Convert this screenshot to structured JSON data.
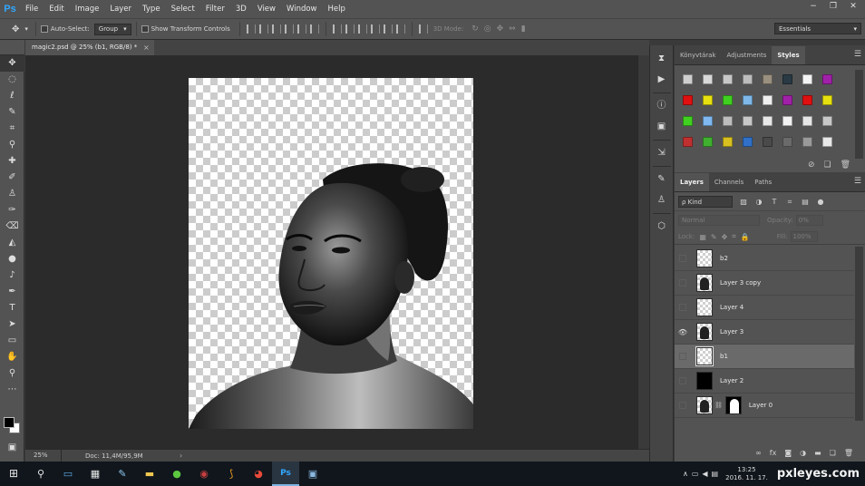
{
  "app": {
    "logo": "Ps",
    "menus": [
      "File",
      "Edit",
      "Image",
      "Layer",
      "Type",
      "Select",
      "Filter",
      "3D",
      "View",
      "Window",
      "Help"
    ],
    "window_controls": [
      "−",
      "❐",
      "✕"
    ]
  },
  "options_bar": {
    "auto_select_label": "Auto-Select:",
    "auto_select_target": "Group",
    "transform_controls_label": "Show Transform Controls",
    "mode_3d_label": "3D Mode:",
    "workspace": "Essentials"
  },
  "document": {
    "tab_title": "magic2.psd @ 25% (b1, RGB/8) *",
    "tab_close": "×",
    "zoom": "25%",
    "doc_size": "Doc: 11,4M/95,9M",
    "status_arrow": "›"
  },
  "styles_panel": {
    "tabs": [
      "Könyvtárak",
      "Adjustments",
      "Styles"
    ],
    "active_tab": "Styles",
    "swatches": [
      "#cfcfcf",
      "#d9d9d9",
      "#c8c8c8",
      "#bdbdbd",
      "#9a9080",
      "#2a3a44",
      "#f4f4f4",
      "#a020a8",
      "#e01010",
      "#e6e010",
      "#40d020",
      "#7fb8e8",
      "#f0f0f0",
      "#a020a8",
      "#e01010",
      "#e6e010",
      "#40d020",
      "#80b8f0",
      "#bdbdbd",
      "#c8c8c8",
      "#e8e8e8",
      "#f2f2f2",
      "#e6e6e6",
      "#c8c8c8",
      "#c03030",
      "#40b030",
      "#d8c020",
      "#3070c8",
      "#4a4a4a",
      "#6a6a6a",
      "#9a9a9a",
      "#e8e8e8"
    ]
  },
  "layers_panel": {
    "tabs": [
      "Layers",
      "Channels",
      "Paths"
    ],
    "active_tab": "Layers",
    "kind_label": "ρ Kind",
    "blend_mode": "Normal",
    "opacity_label": "Opacity:",
    "opacity_value": "0%",
    "lock_label": "Lock:",
    "fill_label": "Fill:",
    "fill_value": "100%",
    "layers": [
      {
        "name": "b2",
        "visible": false,
        "thumb": "transparent"
      },
      {
        "name": "Layer 3 copy",
        "visible": false,
        "thumb": "face"
      },
      {
        "name": "Layer 4",
        "visible": false,
        "thumb": "transparent"
      },
      {
        "name": "Layer 3",
        "visible": true,
        "thumb": "face"
      },
      {
        "name": "b1",
        "visible": false,
        "thumb": "transparent",
        "selected": true
      },
      {
        "name": "Layer 2",
        "visible": false,
        "thumb": "black"
      },
      {
        "name": "Layer 0",
        "visible": false,
        "thumb": "face",
        "mask": true
      }
    ]
  },
  "taskbar": {
    "time": "13:25",
    "date": "2016. 11. 17.",
    "watermark": "pxleyes.com"
  }
}
